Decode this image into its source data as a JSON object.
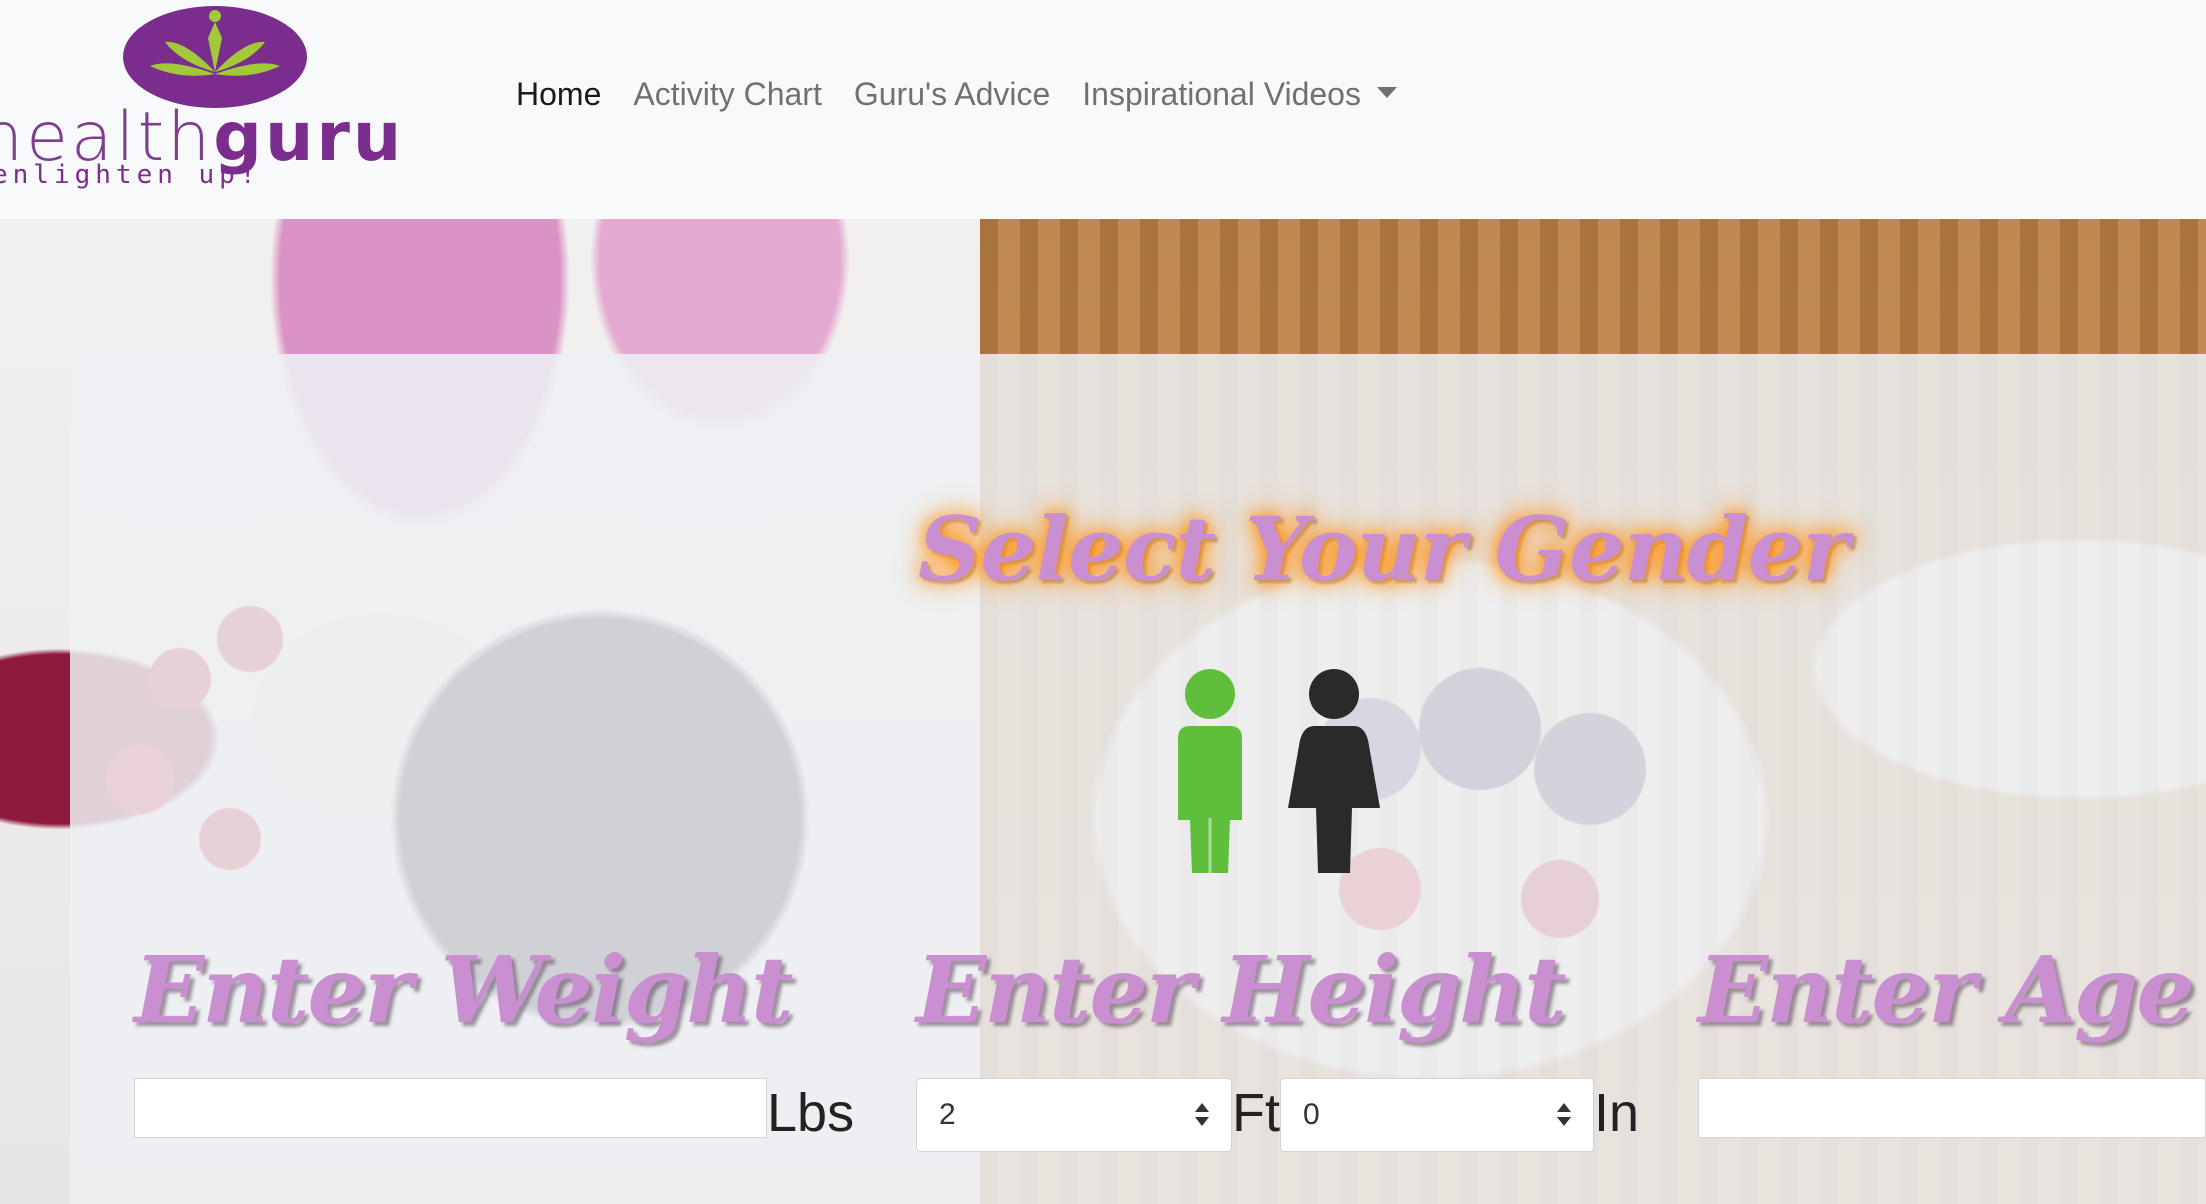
{
  "brand": {
    "name_part1": "health",
    "name_part2": "guru",
    "tagline": "enlighten up!",
    "colors": {
      "purple": "#7a2d8c",
      "leaf_green": "#a3c93a"
    }
  },
  "nav": {
    "items": [
      {
        "label": "Home",
        "active": true
      },
      {
        "label": "Activity Chart",
        "active": false
      },
      {
        "label": "Guru's Advice",
        "active": false
      },
      {
        "label": "Inspirational Videos",
        "active": false,
        "dropdown": true
      }
    ]
  },
  "gender": {
    "title": "Select Your Gender",
    "male_icon": "male-figure-icon",
    "female_icon": "female-figure-icon",
    "selected": "male",
    "colors": {
      "selected": "#5fbf3c",
      "unselected": "#2a2a2a"
    }
  },
  "weight": {
    "label": "Enter Weight",
    "value": "",
    "unit": "Lbs"
  },
  "height": {
    "label": "Enter Height",
    "feet_value": "2",
    "feet_unit": "Ft",
    "inches_value": "0",
    "inches_unit": "In"
  },
  "age": {
    "label": "Enter Age",
    "value": ""
  }
}
